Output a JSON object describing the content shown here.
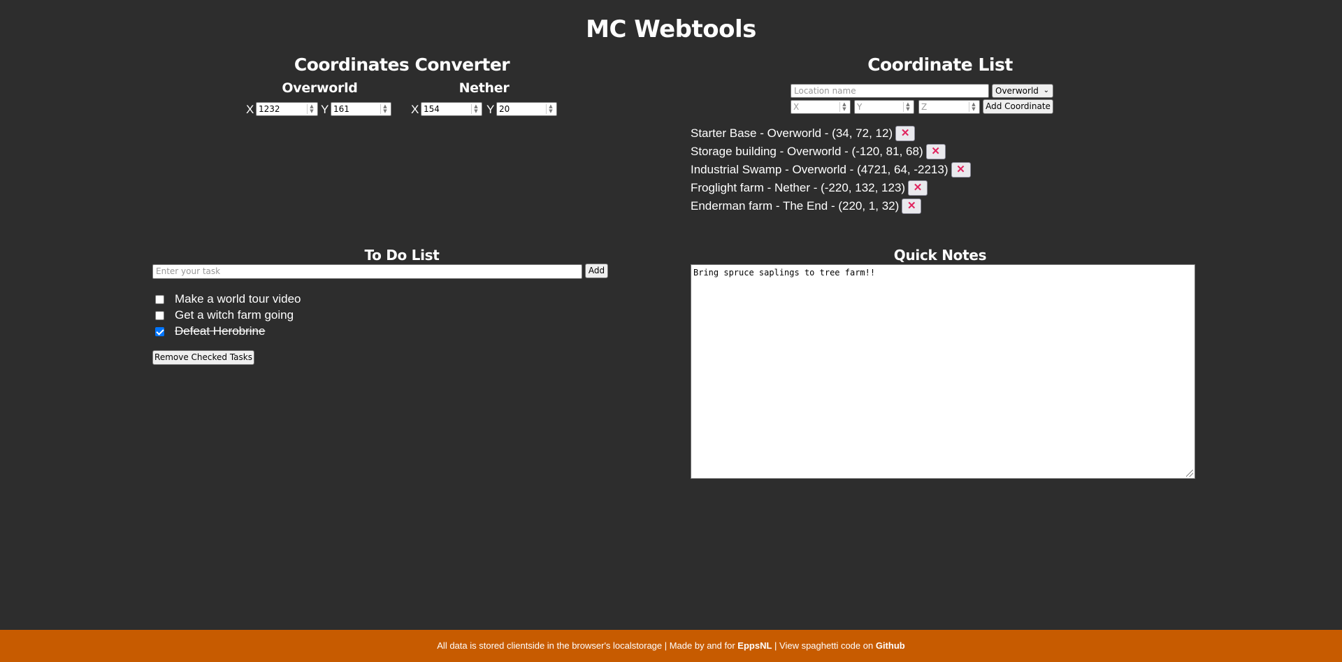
{
  "app": {
    "title": "MC Webtools"
  },
  "converter": {
    "title": "Coordinates Converter",
    "overworld": {
      "heading": "Overworld",
      "x_label": "X",
      "x_value": "1232",
      "y_label": "Y",
      "y_value": "161"
    },
    "nether": {
      "heading": "Nether",
      "x_label": "X",
      "x_value": "154",
      "y_label": "Y",
      "y_value": "20"
    }
  },
  "coord_list": {
    "title": "Coordinate List",
    "name_placeholder": "Location name",
    "dimension_selected": "Overworld",
    "x_placeholder": "X",
    "y_placeholder": "Y",
    "z_placeholder": "Z",
    "add_label": "Add Coordinate",
    "delete_glyph": "✕",
    "entries": [
      "Starter Base - Overworld - (34, 72, 12)",
      "Storage building - Overworld - (-120, 81, 68)",
      "Industrial Swamp - Overworld - (4721, 64, -2213)",
      "Froglight farm - Nether - (-220, 132, 123)",
      "Enderman farm - The End - (220, 1, 32)"
    ]
  },
  "todo": {
    "title": "To Do List",
    "placeholder": "Enter your task",
    "add_label": "Add",
    "remove_label": "Remove Checked Tasks",
    "items": [
      {
        "text": "Make a world tour video",
        "checked": false
      },
      {
        "text": "Get a witch farm going",
        "checked": false
      },
      {
        "text": "Defeat Herobrine",
        "checked": true
      }
    ]
  },
  "notes": {
    "title": "Quick Notes",
    "content": "Bring spruce saplings to tree farm!!"
  },
  "footer": {
    "text1": "All data is stored clientside in the browser's localstorage | Made by and for ",
    "author": "EppsNL",
    "text2": " | View spaghetti code on ",
    "link": "Github"
  },
  "colors": {
    "background": "#2d2d2d",
    "footer": "#c75b00",
    "delete_x": "#e0245e",
    "checkbox_checked": "#0075ff"
  }
}
